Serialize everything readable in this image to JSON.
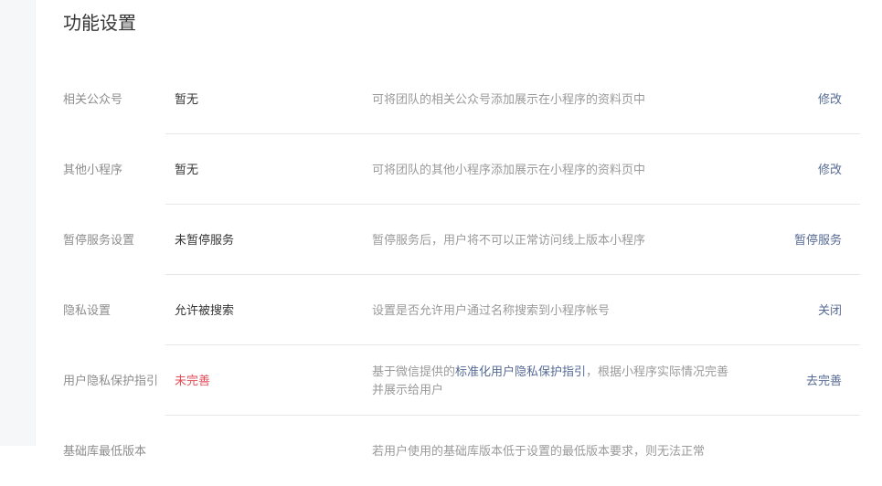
{
  "page": {
    "title": "功能设置"
  },
  "settings": [
    {
      "label": "相关公众号",
      "value": "暂无",
      "description": "可将团队的相关公众号添加展示在小程序的资料页中",
      "action": "修改"
    },
    {
      "label": "其他小程序",
      "value": "暂无",
      "description": "可将团队的其他小程序添加展示在小程序的资料页中",
      "action": "修改"
    },
    {
      "label": "暂停服务设置",
      "value": "未暂停服务",
      "description": "暂停服务后，用户将不可以正常访问线上版本小程序",
      "action": "暂停服务"
    },
    {
      "label": "隐私设置",
      "value": "允许被搜索",
      "description": "设置是否允许用户通过名称搜索到小程序帐号",
      "action": "关闭"
    },
    {
      "label": "用户隐私保护指引",
      "value": "未完善",
      "description_before": "基于微信提供的",
      "description_link": "标准化用户隐私保护指引",
      "description_after": "，根据小程序实际情况完善并展示给用户",
      "action": "去完善"
    },
    {
      "label": "基础库最低版本",
      "value": "",
      "description": "若用户使用的基础库版本低于设置的最低版本要求，则无法正常",
      "action": ""
    }
  ],
  "colors": {
    "link": "#576b95",
    "warning": "#e24e58",
    "label": "#8d8d8d",
    "description": "#9a9a9a",
    "divider": "#e7e7eb"
  }
}
